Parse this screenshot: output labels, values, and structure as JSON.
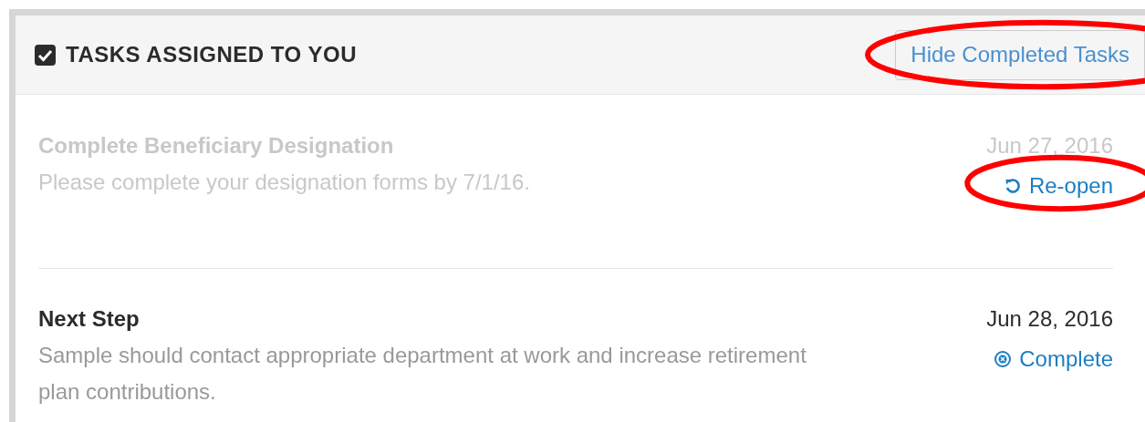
{
  "panel": {
    "title": "TASKS ASSIGNED TO YOU",
    "hide_button": {
      "label": "Hide Completed Tasks",
      "highlighted": true
    }
  },
  "tasks": [
    {
      "title": "Complete Beneficiary Designation",
      "description": "Please complete your designation forms by 7/1/16.",
      "date": "Jun 27, 2016",
      "completed": true,
      "action": {
        "kind": "reopen",
        "label": "Re-open",
        "highlighted": true
      }
    },
    {
      "title": "Next Step",
      "description": "Sample should contact appropriate department at work and increase retirement plan contributions.",
      "date": "Jun 28, 2016",
      "completed": false,
      "action": {
        "kind": "complete",
        "label": "Complete",
        "highlighted": false
      }
    }
  ]
}
